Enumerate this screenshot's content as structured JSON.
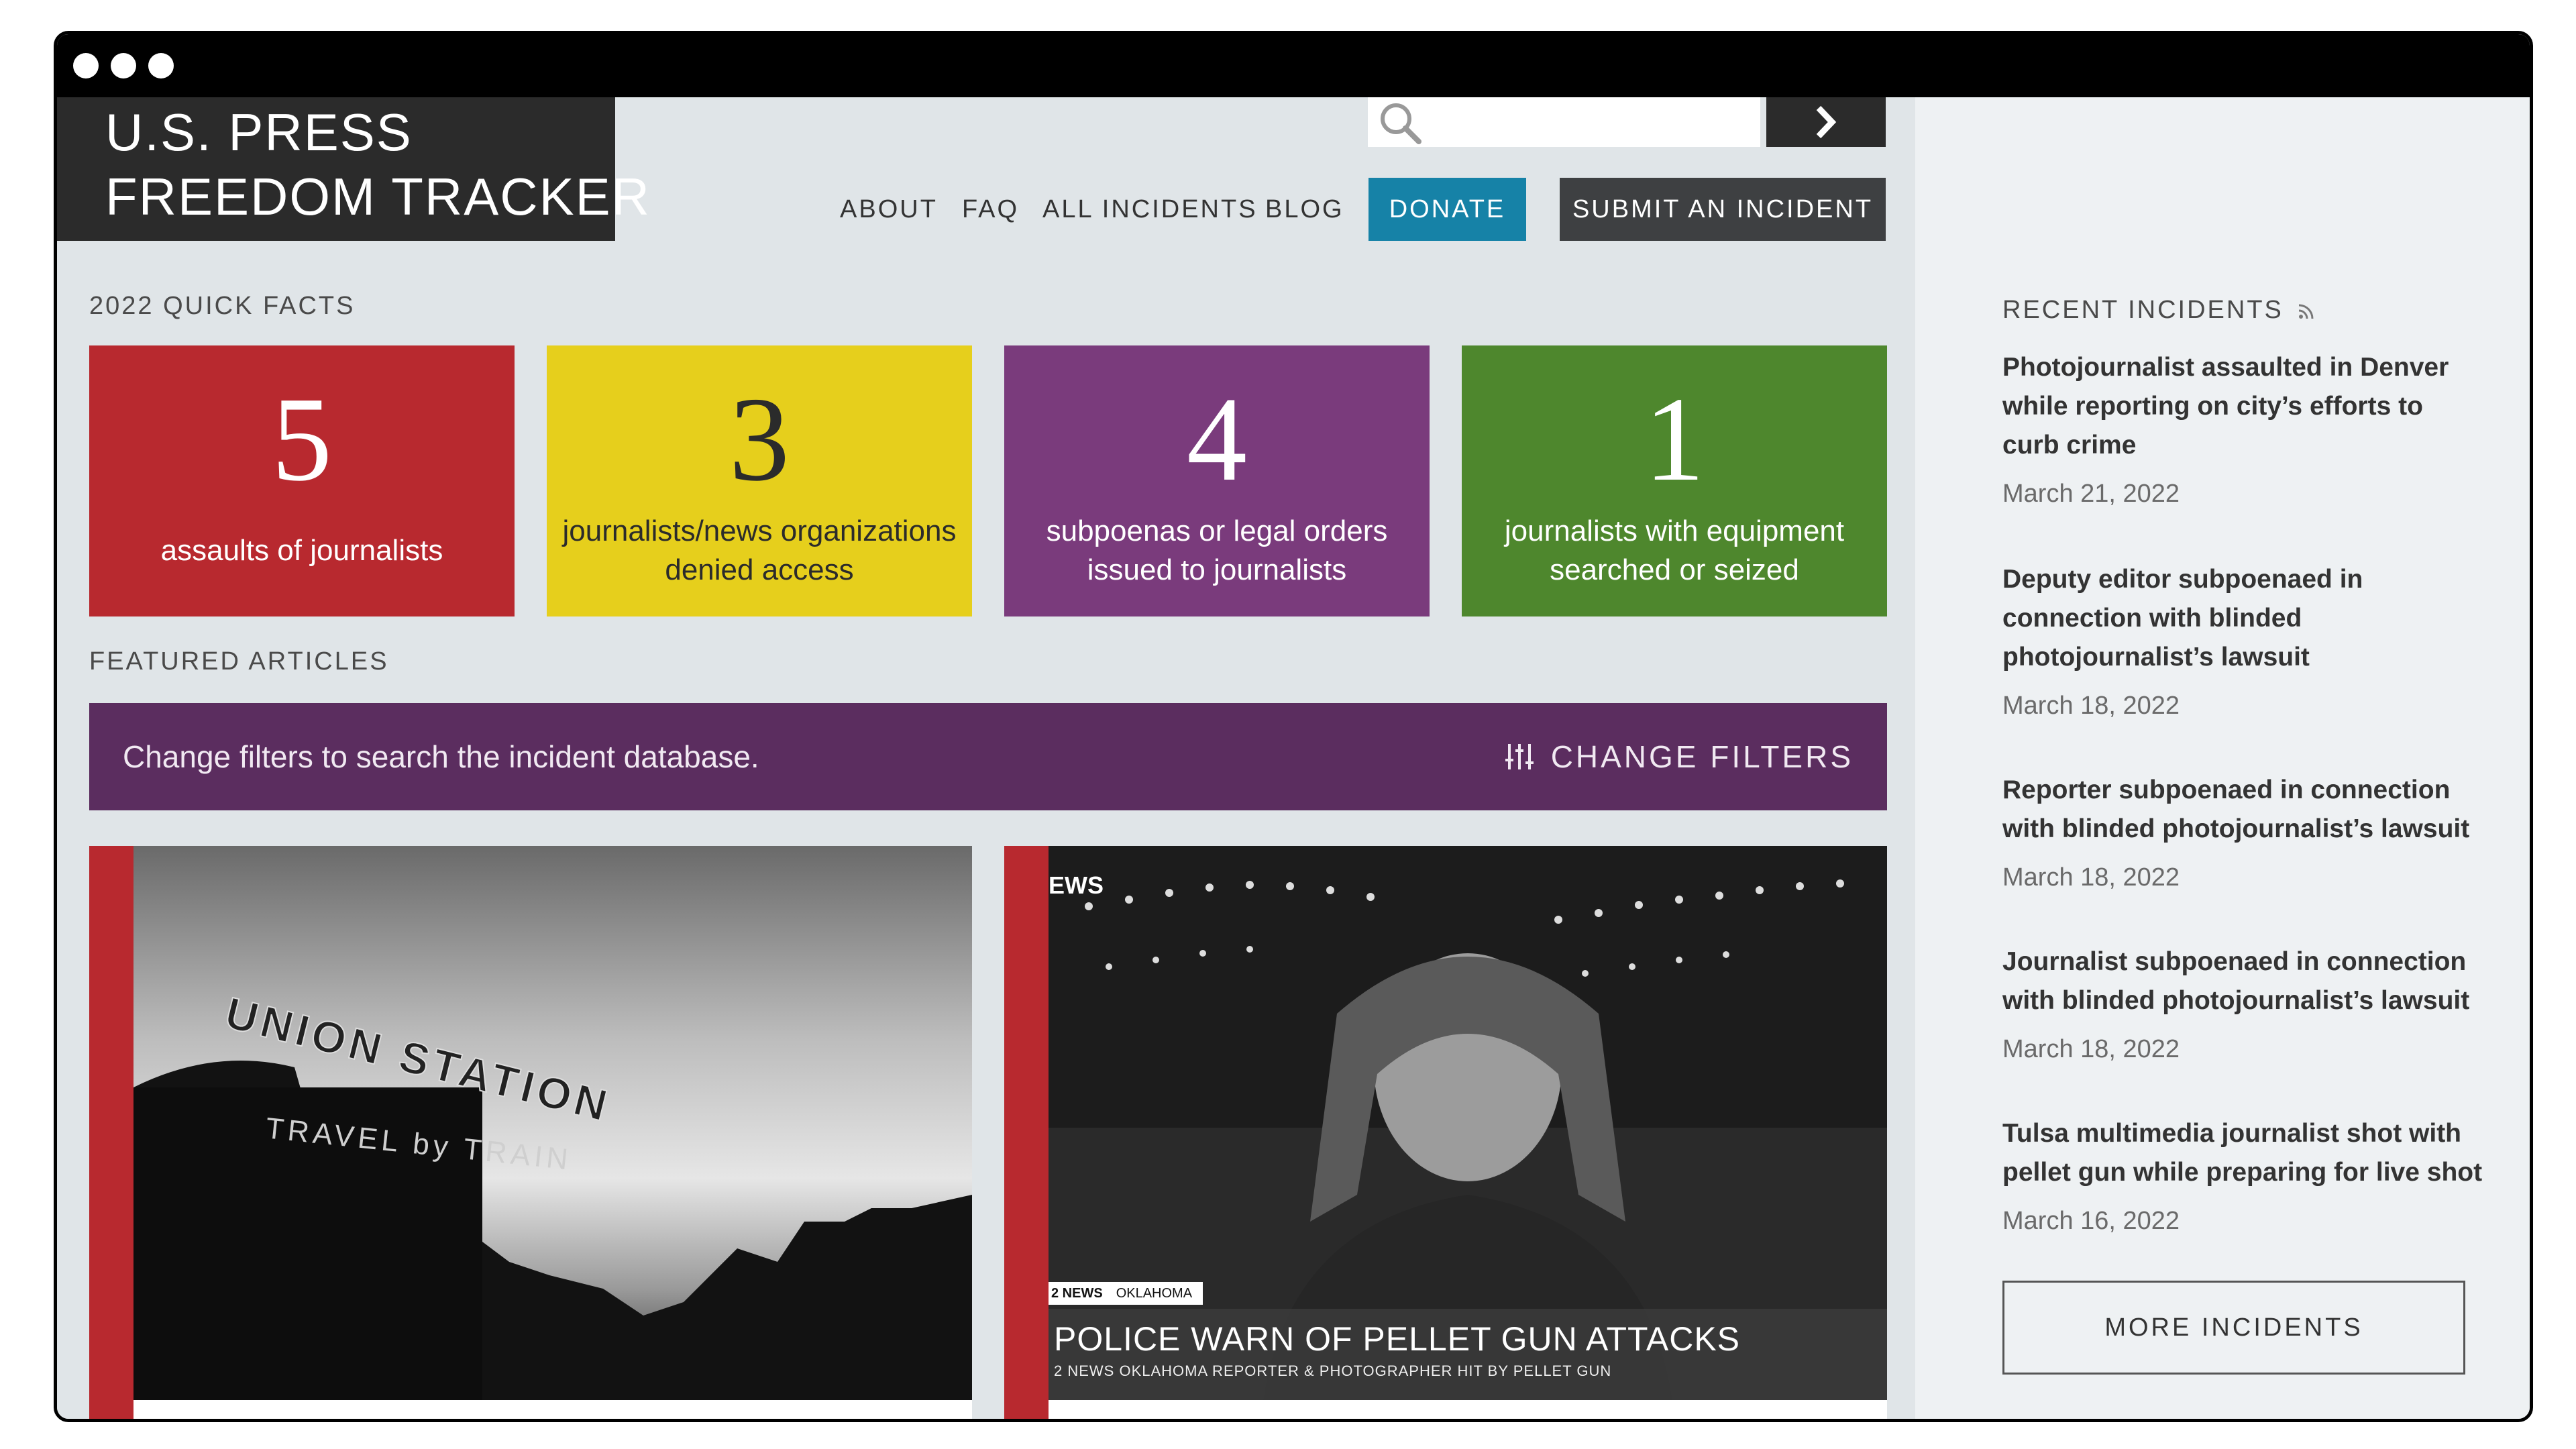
{
  "header": {
    "logo_line1": "U.S. PRESS",
    "logo_line2": "FREEDOM TRACKER",
    "nav": [
      "ABOUT",
      "FAQ",
      "ALL INCIDENTS",
      "BLOG"
    ],
    "donate_label": "DONATE",
    "submit_label": "SUBMIT AN INCIDENT",
    "search_placeholder": "",
    "icons": {
      "search": "search-icon",
      "go": "chevron-right-icon"
    }
  },
  "quick_facts": {
    "label": "2022 QUICK FACTS",
    "items": [
      {
        "number": "5",
        "text": "assaults of journalists",
        "color": "#b8292f"
      },
      {
        "number": "3",
        "text": "journalists/news organizations denied access",
        "color": "#e6cf1c"
      },
      {
        "number": "4",
        "text": "subpoenas or legal orders issued to journalists",
        "color": "#7a3b7c"
      },
      {
        "number": "1",
        "text": "journalists with equipment searched or seized",
        "color": "#4e872d"
      }
    ]
  },
  "featured": {
    "label": "FEATURED ARTICLES",
    "filter_text": "Change filters to search the incident database.",
    "filter_button": "CHANGE FILTERS",
    "filter_icon": "sliders-icon",
    "photo1_sign_top": "UNION STATION",
    "photo1_sign_bottom": "TRAVEL by TRAIN",
    "photo2_logo": "EWS",
    "photo2_tag1": "2 NEWS",
    "photo2_tag2": "OKLAHOMA",
    "photo2_headline": "POLICE WARN OF PELLET GUN ATTACKS",
    "photo2_sub": "2 NEWS OKLAHOMA REPORTER & PHOTOGRAPHER HIT BY PELLET GUN"
  },
  "sidebar": {
    "title": "RECENT INCIDENTS",
    "rss_icon": "rss-icon",
    "incidents": [
      {
        "title": "Photojournalist assaulted in Denver while reporting on city’s efforts to curb crime",
        "date": "March 21, 2022"
      },
      {
        "title": "Deputy editor subpoenaed in connection with blinded photojournalist’s lawsuit",
        "date": "March 18, 2022"
      },
      {
        "title": "Reporter subpoenaed in connection with blinded photojournalist’s lawsuit",
        "date": "March 18, 2022"
      },
      {
        "title": "Journalist subpoenaed in connection with blinded photojournalist’s lawsuit",
        "date": "March 18, 2022"
      },
      {
        "title": "Tulsa multimedia journalist shot with pellet gun while preparing for live shot",
        "date": "March 16, 2022"
      }
    ],
    "more_label": "MORE INCIDENTS"
  }
}
